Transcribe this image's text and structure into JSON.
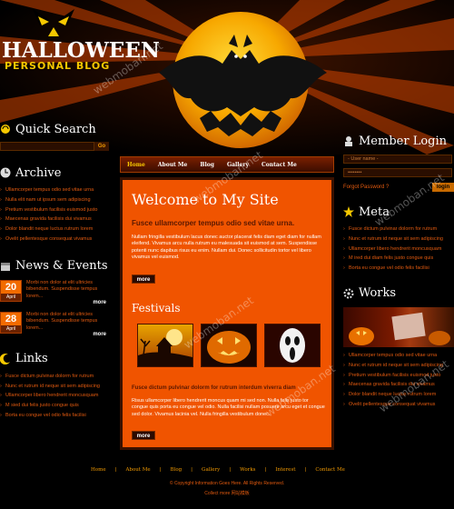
{
  "header": {
    "logo_title": "HALLOWEEN",
    "logo_subtitle": "PERSONAL BLOG"
  },
  "nav": [
    "Home",
    "About Me",
    "Blog",
    "Gallery",
    "Contact Me"
  ],
  "quick_search": {
    "title": "Quick Search",
    "button": "Go"
  },
  "archive": {
    "title": "Archive",
    "items": [
      "Ullamcorper tempus odio sed vitae urna",
      "Nulla elit nam ut ipsum sem adipiscing",
      "Pretium vestibulum facilisis euismod justo",
      "Maecenas gravida facilisis dui vivamus",
      "Dolor blandit neque luctus rutrum lorem",
      "Ovelit pellentesque consequat vivamus"
    ]
  },
  "news": {
    "title": "News & Events",
    "items": [
      {
        "day": "20",
        "month": "April",
        "text": "Morbi non dolor at elit ultricies bibendum. Suspendisse tempus lorem...",
        "more": "more"
      },
      {
        "day": "28",
        "month": "April",
        "text": "Morbi non dolor at elit ultricies bibendum. Suspendisse tempus lorem...",
        "more": "more"
      }
    ]
  },
  "links": {
    "title": "Links",
    "items": [
      "Fusce dictum pulvinar dolorm for rutrum",
      "Nunc et rutrum id neque sit sem adipiscing",
      "Ullamcorper libero hendrerit moncusquam",
      "M sied dui felis justo congue quis",
      "Borta eu congue vel odio felis facilisi"
    ]
  },
  "main": {
    "welcome_title": "Welcome to My Site",
    "welcome_subtitle": "Fusce ullamcorper tempus odio sed vitae urna.",
    "welcome_text": "Nullam fringilla vestibulum lacus donec auctor placerat felis diam eget diam for nullam eleifend. Vivamus arcu nulla rutrum eu malesuada sit euismod at sem. Suspendisse potenti nunc dapibus risus eu enim. Nullam dui. Donec sollicitudin tortor vel libero vivamus vel euismod.",
    "more": "more",
    "festivals_title": "Festivals",
    "festivals_subtitle": "Fusce dictum pulvinar dolorm for rutrum interdum viverra diam",
    "festivals_text": "Risus ullamcorper libero hendrerit moncus quam mi sed non. Nulla felis justo tor congue quis porta eu congue vel odio. Nulla facilisi nullam posuere arcu eget et congue sed dolor. Vivamus lacinia vel. Nulla fringilla vestibulum donec.",
    "more2": "more"
  },
  "member_login": {
    "title": "Member Login",
    "username_placeholder": "- User name -",
    "password_placeholder": "••••••••",
    "forgot": "Forgot Password ?",
    "login": "login"
  },
  "meta": {
    "title": "Meta",
    "items": [
      "Fusce dictum pulvinar dolorm for rutrum",
      "Nunc et rutrum id neque sit sem adipiscing",
      "Ullamcorper libero hendrerit moncusquam",
      "M ired dui diam felis justo congue quis",
      "Borta eu congue vel odio felis facilisi"
    ]
  },
  "works": {
    "title": "Works",
    "items": [
      "Ullamcorper tempus odio sed vitae urna",
      "Nunc et rutrum id neque sit sem adipiscing",
      "Pretium vestibulum facilisis euismod justo",
      "Maecenas gravida facilisis dui vivamus",
      "Dolor blandit neque luctus rutrum lorem",
      "Ovelit pellentesque consequat vivamus"
    ]
  },
  "footer": {
    "links": [
      "Home",
      "About Me",
      "Blog",
      "Gallery",
      "Works",
      "Interest",
      "Contact Me"
    ],
    "copyright": "© Copyright Information Goes Here. All Rights Reserved.",
    "line2": "Collect more 网站模板"
  },
  "watermark": "webmoban.net",
  "colors": {
    "accent": "#f05400",
    "link": "#e25a0f",
    "gold": "#f9c800"
  }
}
